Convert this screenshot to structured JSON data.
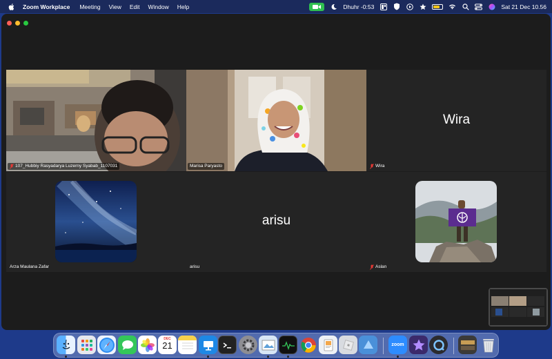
{
  "menubar": {
    "app_name": "Zoom Workplace",
    "menus": [
      "Meeting",
      "View",
      "Edit",
      "Window",
      "Help"
    ],
    "prayer_time": "Dhuhr -0:53",
    "datetime": "Sat 21 Dec  10.56"
  },
  "tiles": [
    {
      "name": "107_Hubbiy Rasyadarya Luzerny Syabab_1107031",
      "muted": true,
      "type": "video"
    },
    {
      "name": "Marisa Paryasto",
      "muted": false,
      "type": "video"
    },
    {
      "name": "Wira",
      "muted": true,
      "type": "name",
      "display_name": "Wira"
    },
    {
      "name": "Arza Maulana Zafar",
      "muted": false,
      "type": "avatar"
    },
    {
      "name": "arisu",
      "muted": false,
      "type": "name",
      "display_name": "arisu"
    },
    {
      "name": "Aslan",
      "muted": true,
      "type": "avatar"
    }
  ],
  "dock": {
    "calendar_month": "DEC",
    "calendar_day": "21",
    "apps": [
      "finder",
      "launchpad",
      "safari",
      "messages",
      "photos",
      "calendar",
      "notes",
      "keynote",
      "terminal",
      "system-settings",
      "preview",
      "activity-monitor",
      "chrome",
      "files",
      "roblox",
      "zoom",
      "imovie",
      "quicktime",
      "finder-window",
      "trash"
    ]
  }
}
